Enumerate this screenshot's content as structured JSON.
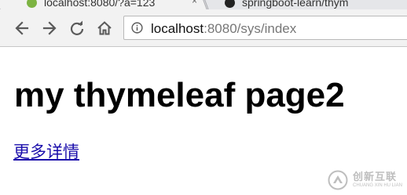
{
  "tabs": [
    {
      "title": "localhost:8080/?a=123",
      "close": "×"
    },
    {
      "title": "springboot-learn/thym",
      "close": ""
    }
  ],
  "toolbar": {
    "back_icon": "back-arrow-icon",
    "forward_icon": "forward-arrow-icon",
    "reload_icon": "reload-icon",
    "home_icon": "home-icon"
  },
  "address_bar": {
    "security_icon": "info-icon",
    "url_host": "localhost",
    "url_rest": ":8080/sys/index"
  },
  "page": {
    "heading": "my thymeleaf page2",
    "link_text": "更多详情"
  },
  "watermark": {
    "title_cn": "创新互联",
    "subtitle_en": "CHUANG XIN HU LIAN"
  },
  "colors": {
    "link": "#1a0dab",
    "toolbar_bg": "#f2f2f2",
    "tabstrip_bg": "#dadbdf"
  }
}
